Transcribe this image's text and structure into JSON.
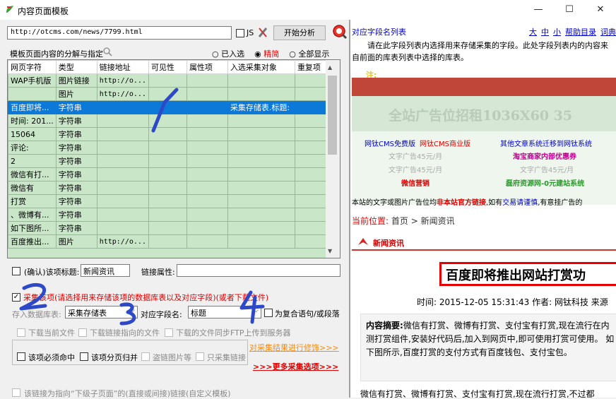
{
  "window": {
    "title": "内容页面模板",
    "minimize": "—",
    "maximize": "☐",
    "close": "✕"
  },
  "top": {
    "url": "http://otcms.com/news/7799.html",
    "js_label": "JS",
    "analyze_btn": "开始分析"
  },
  "group": {
    "title": "模板页面内容的分解与指定",
    "radios": [
      "已入选",
      "精简",
      "全部显示"
    ]
  },
  "table": {
    "headers": [
      "网页字符",
      "类型",
      "链接地址",
      "可见性",
      "属性项",
      "入选采集对象",
      "重复项"
    ],
    "rows": [
      [
        "WAP手机版",
        "图片链接",
        "http://o...",
        "",
        "",
        "",
        ""
      ],
      [
        "",
        "图片",
        "http://o...",
        "",
        "",
        "",
        ""
      ],
      [
        "百度即将...",
        "字符串",
        "",
        "",
        "",
        "采集存储表.标题:",
        ""
      ],
      [
        "时间: 201...",
        "字符串",
        "",
        "",
        "",
        "",
        ""
      ],
      [
        "15064",
        "字符串",
        "",
        "",
        "",
        "",
        ""
      ],
      [
        "评论:",
        "字符串",
        "",
        "",
        "",
        "",
        ""
      ],
      [
        "2",
        "字符串",
        "",
        "",
        "",
        "",
        ""
      ],
      [
        "微信有打...",
        "字符串",
        "",
        "",
        "",
        "",
        ""
      ],
      [
        "微信有",
        "字符串",
        "",
        "",
        "",
        "",
        ""
      ],
      [
        "打赏",
        "字符串",
        "",
        "",
        "",
        "",
        ""
      ],
      [
        "、微博有...",
        "字符串",
        "",
        "",
        "",
        "",
        ""
      ],
      [
        "如下图所...",
        "字符串",
        "",
        "",
        "",
        "",
        ""
      ],
      [
        "百度推出...",
        "图片",
        "http://o...",
        "",
        "",
        "",
        ""
      ]
    ]
  },
  "confirm": {
    "label": "(确认)该项标题:",
    "value": "新闻资讯",
    "attr_label": "链接属性:"
  },
  "collect": {
    "label": "采集该项(请选择用来存储该项的数据库表以及对应字段)(或者下载文件)",
    "db_label": "存入数据库表:",
    "db_value": "采集存储表",
    "field_label": "对应字段名:",
    "field_value": "标题",
    "compound_label": "为复合语句/或段落",
    "opts1": [
      "下载当前文件",
      "下载链接指向的文件",
      "下载的文件同步FTP上传到服务器"
    ],
    "opts2": [
      "该项必须命中",
      "该项分页归并",
      "盗链图片等",
      "只采集链接"
    ],
    "modify_link": "对采集结果进行修饰>>>",
    "more_link": ">>>更多采集选项>>>"
  },
  "bottom": {
    "label": "该链接为指向“下级子页面”的(直接或间接)链接(自定义模板)"
  },
  "help": {
    "title": "对应字段名列表",
    "sizes": [
      "大",
      "中",
      "小"
    ],
    "help_links": [
      "帮助目录",
      "词典"
    ],
    "text": "请在此字段列表内选择用来存储采集的字段。此处字段列表内的内容来自前面的库表列表中选择的库表。",
    "note": "注:"
  },
  "page": {
    "banner": "全站广告位招租1036X60  35",
    "links_row1": [
      "网钛CMS免费版",
      "网钛CMS商业版",
      "其他文章系统迁移到网钛系统"
    ],
    "ad1": "文字广告45元/月",
    "ad1b": "淘宝商家内部优惠券",
    "ad2": "文字广告45元/月",
    "ad2b": "文字广告45元/月",
    "ad3": "微信营销",
    "ad3b": "磊府资源网-0元建站系统",
    "notice_a": "本站的文字或图片广告位均",
    "notice_b": "非本站官方链接",
    "notice_c": ",如有",
    "notice_d": "交易请谨慎",
    ",notice_e": "",
    "notice_f": ",有意挂广告的",
    "crumb_label": "当前位置:",
    "crumb_home": "首页",
    "crumb_sep": ">",
    "crumb_cur": "新闻资讯",
    "section": "新闻资讯",
    "article_title": "百度即将推出网站打赏功",
    "meta": "时间: 2015-12-05 15:31:43 作者: 网钛科技 来源",
    "summary_label": "内容摘要:",
    "summary": "微信有打赏、微博有打赏、支付宝有打赏,现在流行在内测打赏组件,安装好代码后,加入到网页中,即可使用打赏可使用。 如下图所示,百度打赏的支付方式有百度钱包、支付宝包。",
    "para": "微信有打赏、微博有打赏、支付宝有打赏,现在流行打赏,不过都"
  },
  "colors": {
    "grid": "#c9e6c9",
    "select": "#0c78d8",
    "annot": "#2d49c8",
    "red": "#e00000",
    "banner": "#d6e7d6"
  }
}
